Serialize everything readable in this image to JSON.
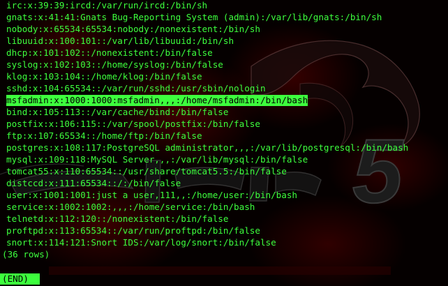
{
  "terminal": {
    "lines": [
      "irc:x:39:39:ircd:/var/run/ircd:/bin/sh",
      "gnats:x:41:41:Gnats Bug-Reporting System (admin):/var/lib/gnats:/bin/sh",
      "nobody:x:65534:65534:nobody:/nonexistent:/bin/sh",
      "libuuid:x:100:101::/var/lib/libuuid:/bin/sh",
      "dhcp:x:101:102::/nonexistent:/bin/false",
      "syslog:x:102:103::/home/syslog:/bin/false",
      "klog:x:103:104::/home/klog:/bin/false",
      "sshd:x:104:65534::/var/run/sshd:/usr/sbin/nologin",
      "msfadmin:x:1000:1000:msfadmin,,,:/home/msfadmin:/bin/bash",
      "bind:x:105:113::/var/cache/bind:/bin/false",
      "postfix:x:106:115::/var/spool/postfix:/bin/false",
      "ftp:x:107:65534::/home/ftp:/bin/false",
      "postgres:x:108:117:PostgreSQL administrator,,,:/var/lib/postgresql:/bin/bash",
      "mysql:x:109:118:MySQL Server,,,:/var/lib/mysql:/bin/false",
      "tomcat55:x:110:65534::/usr/share/tomcat5.5:/bin/false",
      "distccd:x:111:65534::/:/bin/false",
      "user:x:1001:1001:just a user,111,,:/home/user:/bin/bash",
      "service:x:1002:1002:,,,:/home/service:/bin/bash",
      "telnetd:x:112:120::/nonexistent:/bin/false",
      "proftpd:x:113:65534::/var/run/proftpd:/bin/false",
      "snort:x:114:121:Snort IDS:/var/log/snort:/bin/false"
    ],
    "highlighted_index": 8,
    "rows_summary": "(36 rows)",
    "pager_status": "(END)"
  },
  "colors": {
    "terminal_text": "#3dff3d",
    "highlight_bg": "#3dff3d",
    "highlight_text": "#000000",
    "wallpaper_red": "#6e0000"
  },
  "wallpaper": {
    "logo_number": "5"
  }
}
